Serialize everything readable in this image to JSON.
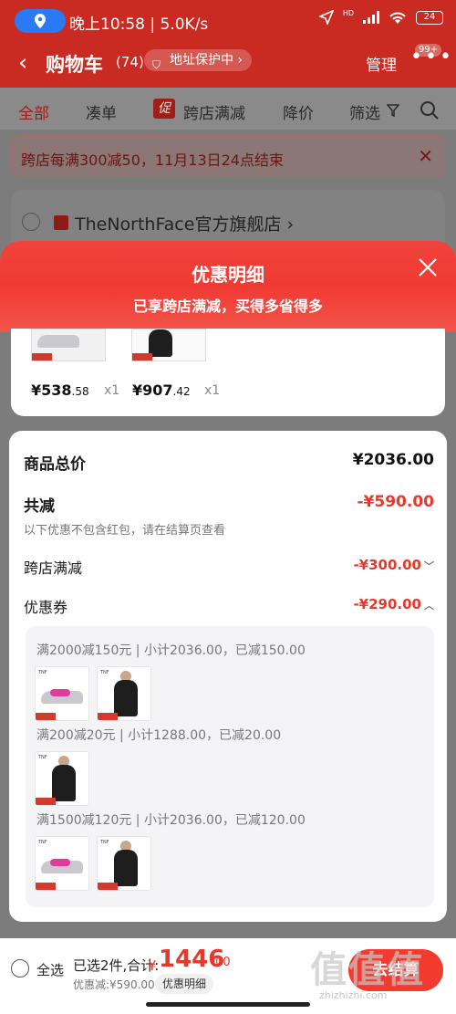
{
  "status": {
    "time": "晚上10:58 | 5.0K/s",
    "battery": "24",
    "signal": "HD"
  },
  "header": {
    "back_icon": "‹",
    "title": "购物车",
    "count": "(74)",
    "address_badge": "地址保护中",
    "address_arrow": "›",
    "manage": "管理",
    "more_badge": "99+"
  },
  "tabs": [
    {
      "label": "全部",
      "active": true
    },
    {
      "label": "凑单"
    },
    {
      "label": "跨店满减",
      "badge": "促"
    },
    {
      "label": "降价"
    },
    {
      "label": "筛选"
    }
  ],
  "notice": {
    "text": "跨店每满300减50，11月13日24点结束",
    "close": "✕"
  },
  "store": {
    "name": "TheNorthFace官方旗舰店",
    "arrow": "›"
  },
  "overlay": {
    "title": "优惠明细",
    "subtitle": "已享跨店满减，买得多省得多"
  },
  "items": [
    {
      "price_int": "¥538",
      "price_dec": ".58",
      "qty": "x1"
    },
    {
      "price_int": "¥907",
      "price_dec": ".42",
      "qty": "x1"
    }
  ],
  "details": {
    "total_label": "商品总价",
    "total_value": "¥2036.00",
    "reduce_label": "共减",
    "reduce_value": "-¥590.00",
    "hint": "以下优惠不包含红包，请在结算页查看",
    "cross_store_label": "跨店满减",
    "cross_store_value": "-¥300.00",
    "cross_caret": "﹀",
    "coupon_label": "优惠券",
    "coupon_value": "-¥290.00",
    "coupon_caret": "︿"
  },
  "coupons": [
    {
      "text": "满2000减150元 | 小计2036.00，已减150.00",
      "products": [
        "shoe",
        "jacket"
      ]
    },
    {
      "text": "满200减20元 | 小计1288.00，已减20.00",
      "products": [
        "jacket"
      ]
    },
    {
      "text": "满1500减120元 | 小计2036.00，已减120.00",
      "products": [
        "shoe",
        "jacket"
      ]
    }
  ],
  "bottom": {
    "select_all": "全选",
    "selected": "已选2件,合计:",
    "currency": "¥",
    "total_int": "1446",
    "total_dec": ".00",
    "discount": "优惠减:¥590.00",
    "detail_btn": "优惠明细",
    "settle": "去结算"
  },
  "watermark": {
    "logo": "值值值",
    "url": "zhizhizhi.com"
  },
  "colors": {
    "brand_red": "#c92a22",
    "accent_red": "#e43a2e",
    "overlay_red": "#f03a33"
  }
}
